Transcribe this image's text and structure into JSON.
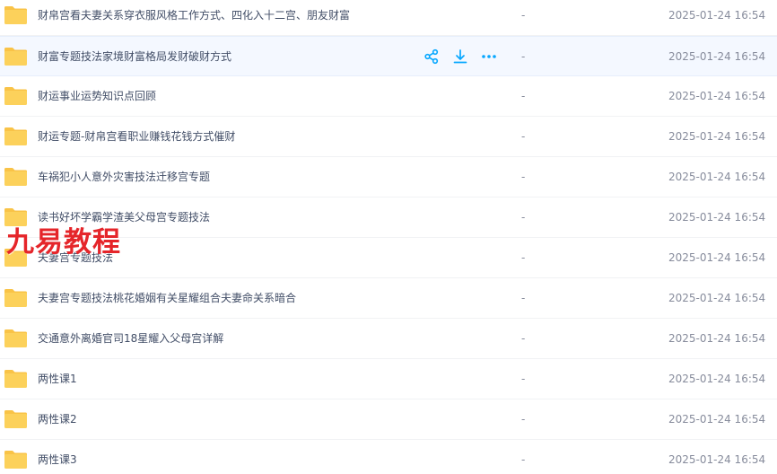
{
  "files": [
    {
      "name": "财帛宫看夫妻关系穿衣服风格工作方式、四化入十二宫、朋友财富",
      "size": "-",
      "modified": "2025-01-24 16:54"
    },
    {
      "name": "财富专题技法家境财富格局发财破财方式",
      "size": "-",
      "modified": "2025-01-24 16:54"
    },
    {
      "name": "财运事业运势知识点回顾",
      "size": "-",
      "modified": "2025-01-24 16:54"
    },
    {
      "name": "财运专题-财帛宫看职业赚钱花钱方式催财",
      "size": "-",
      "modified": "2025-01-24 16:54"
    },
    {
      "name": "车祸犯小人意外灾害技法迁移宫专题",
      "size": "-",
      "modified": "2025-01-24 16:54"
    },
    {
      "name": "读书好坏学霸学渣美父母宫专题技法",
      "size": "-",
      "modified": "2025-01-24 16:54"
    },
    {
      "name": "夫妻宫专题技法",
      "size": "-",
      "modified": "2025-01-24 16:54"
    },
    {
      "name": "夫妻宫专题技法桃花婚姻有关星耀组合夫妻命关系暗合",
      "size": "-",
      "modified": "2025-01-24 16:54"
    },
    {
      "name": "交通意外离婚官司18星耀入父母宫详解",
      "size": "-",
      "modified": "2025-01-24 16:54"
    },
    {
      "name": "两性课1",
      "size": "-",
      "modified": "2025-01-24 16:54"
    },
    {
      "name": "两性课2",
      "size": "-",
      "modified": "2025-01-24 16:54"
    },
    {
      "name": "两性课3",
      "size": "-",
      "modified": "2025-01-24 16:54"
    }
  ],
  "hovered_row": 1,
  "row_actions": [
    "share-icon",
    "download-icon",
    "more-icon"
  ],
  "watermark": "九易教程",
  "colors": {
    "folder": "#fcd15b",
    "folder_tab": "#f9c347",
    "action_icon": "#06a7ff",
    "hover_bg": "#f4f8ff",
    "text": "#424e67",
    "meta_text": "#878c9c",
    "watermark": "#e5252a"
  }
}
